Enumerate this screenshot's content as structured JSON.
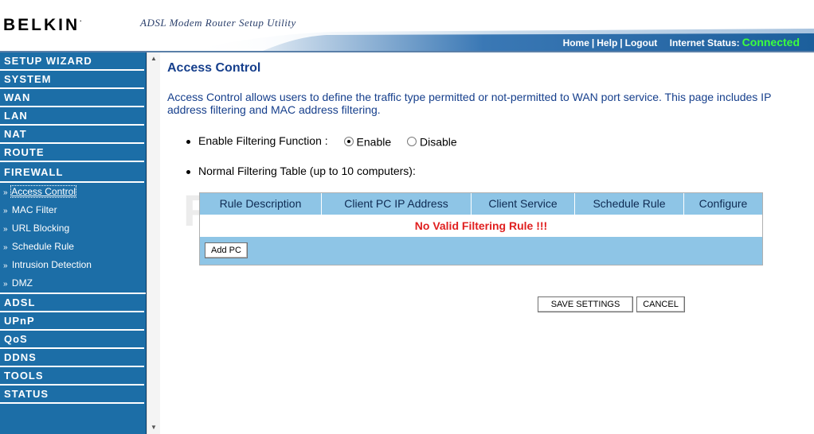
{
  "header": {
    "brand": "BELKIN",
    "brand_mark": ".",
    "subtitle": "ADSL Modem Router Setup Utility",
    "links": [
      "Home",
      "Help",
      "Logout"
    ],
    "status_label": "Internet Status:",
    "status_value": "Connected",
    "status_color": "#3dff3d"
  },
  "sidebar": {
    "items": [
      {
        "label": "SETUP WIZARD"
      },
      {
        "label": "SYSTEM"
      },
      {
        "label": "WAN"
      },
      {
        "label": "LAN"
      },
      {
        "label": "NAT"
      },
      {
        "label": "ROUTE"
      },
      {
        "label": "FIREWALL"
      }
    ],
    "firewall_sub": [
      {
        "label": "Access Control",
        "active": true
      },
      {
        "label": "MAC Filter"
      },
      {
        "label": "URL Blocking"
      },
      {
        "label": "Schedule Rule"
      },
      {
        "label": "Intrusion Detection"
      },
      {
        "label": "DMZ"
      }
    ],
    "items_after": [
      {
        "label": "ADSL"
      },
      {
        "label": "UPnP"
      },
      {
        "label": "QoS"
      },
      {
        "label": "DDNS"
      },
      {
        "label": "TOOLS"
      },
      {
        "label": "STATUS"
      }
    ],
    "chevron": "»",
    "bg_color": "#1c6ea7"
  },
  "main": {
    "title": "Access Control",
    "description": "Access Control allows users to define the traffic type permitted or not-permitted to WAN port service. This page includes IP address filtering and MAC address filtering.",
    "filter_label": "Enable Filtering Function :",
    "enable_label": "Enable",
    "disable_label": "Disable",
    "enabled": true,
    "table_label": "Normal Filtering Table (up to 10 computers):",
    "table": {
      "columns": [
        "Rule Description",
        "Client PC IP Address",
        "Client Service",
        "Schedule Rule",
        "Configure"
      ],
      "empty_message": "No Valid Filtering Rule !!!",
      "add_label": "Add PC"
    },
    "save_label": "SAVE SETTINGS",
    "cancel_label": "CANCEL"
  },
  "watermark": "PcWinTech.com"
}
